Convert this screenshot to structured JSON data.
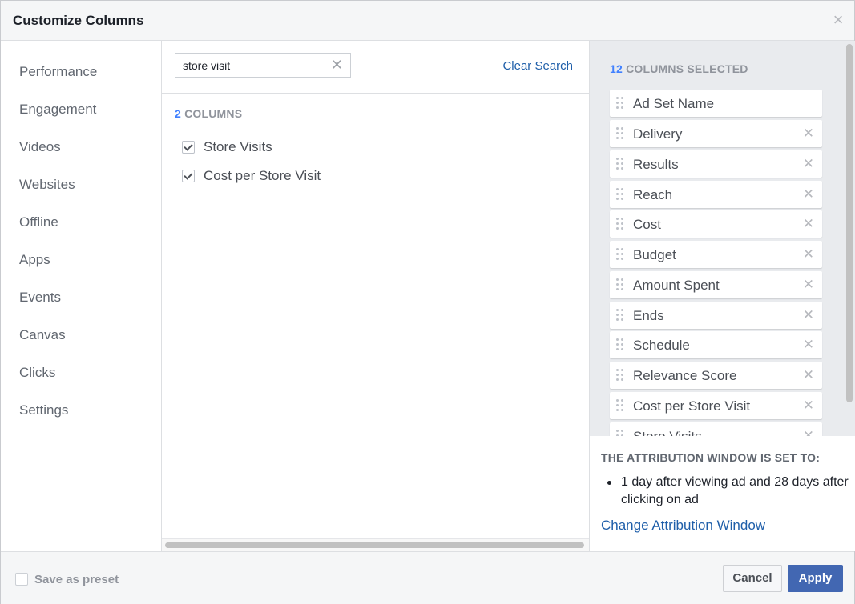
{
  "dialog": {
    "title": "Customize Columns",
    "close_icon": "close-icon"
  },
  "sidebar": {
    "items": [
      {
        "label": "Performance"
      },
      {
        "label": "Engagement"
      },
      {
        "label": "Videos"
      },
      {
        "label": "Websites"
      },
      {
        "label": "Offline"
      },
      {
        "label": "Apps"
      },
      {
        "label": "Events"
      },
      {
        "label": "Canvas"
      },
      {
        "label": "Clicks"
      },
      {
        "label": "Settings"
      }
    ]
  },
  "search": {
    "value": "store visit",
    "clear_icon": "clear-icon",
    "clear_label": "Clear Search"
  },
  "results": {
    "count": "2",
    "count_label": "COLUMNS",
    "items": [
      {
        "label": "Store Visits",
        "checked": true
      },
      {
        "label": "Cost per Store Visit",
        "checked": true
      }
    ]
  },
  "selected": {
    "count": "12",
    "count_label": "COLUMNS SELECTED",
    "items": [
      {
        "label": "Ad Set Name",
        "removable": false
      },
      {
        "label": "Delivery",
        "removable": true
      },
      {
        "label": "Results",
        "removable": true
      },
      {
        "label": "Reach",
        "removable": true
      },
      {
        "label": "Cost",
        "removable": true
      },
      {
        "label": "Budget",
        "removable": true
      },
      {
        "label": "Amount Spent",
        "removable": true
      },
      {
        "label": "Ends",
        "removable": true
      },
      {
        "label": "Schedule",
        "removable": true
      },
      {
        "label": "Relevance Score",
        "removable": true
      },
      {
        "label": "Cost per Store Visit",
        "removable": true
      },
      {
        "label": "Store Visits",
        "removable": true
      }
    ]
  },
  "attribution": {
    "title": "THE ATTRIBUTION WINDOW IS SET TO:",
    "bullet": "1 day after viewing ad and 28 days after clicking on ad",
    "link": "Change Attribution Window"
  },
  "footer": {
    "preset_label": "Save as preset",
    "cancel_label": "Cancel",
    "apply_label": "Apply"
  },
  "colors": {
    "accent": "#4267b2",
    "link": "#1e5ea9",
    "count_highlight": "#4080ff"
  }
}
